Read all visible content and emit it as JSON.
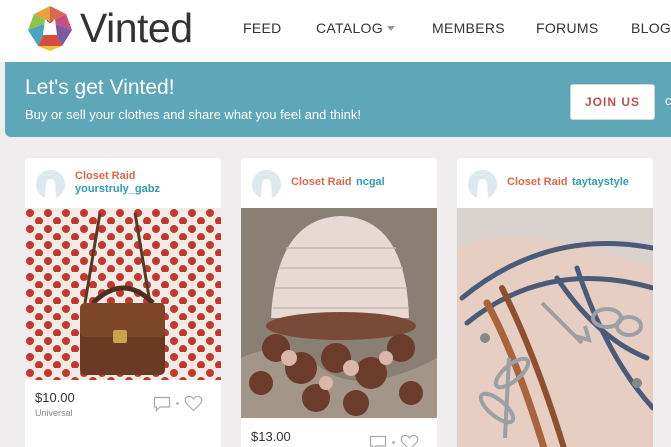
{
  "app": {
    "logo_text": "Vinted"
  },
  "nav": {
    "items": [
      {
        "label": "FEED"
      },
      {
        "label": "CATALOG",
        "has_dropdown": true
      },
      {
        "label": "MEMBERS"
      },
      {
        "label": "FORUMS"
      },
      {
        "label": "BLOG"
      }
    ]
  },
  "banner": {
    "title": "Let's get Vinted!",
    "subtitle": "Buy or sell your clothes and share what you feel and think!",
    "join_label": "JOIN US",
    "cut_text": "c"
  },
  "cards": [
    {
      "brand": "Closet Raid",
      "user": "yourstruly_gabz",
      "price": "$10.00",
      "size": "Universal",
      "image": "brown leather handbag on red polka-dot fabric"
    },
    {
      "brand": "Closet Raid",
      "user": "ncgal",
      "price": "$13.00",
      "size": "",
      "image": "crocheted pink and brown hat"
    },
    {
      "brand": "Closet Raid",
      "user": "taytaystyle",
      "price": "",
      "size": "",
      "image": "leather bracelets with arrow, infinity and dragonfly charms"
    }
  ],
  "icons": {
    "comment": "comment-icon",
    "heart": "heart-icon",
    "avatar": "avatar-icon"
  },
  "colors": {
    "banner": "#5ea7b8",
    "brand": "#d9694b",
    "user": "#2f9db2",
    "join_text": "#c0504d"
  }
}
